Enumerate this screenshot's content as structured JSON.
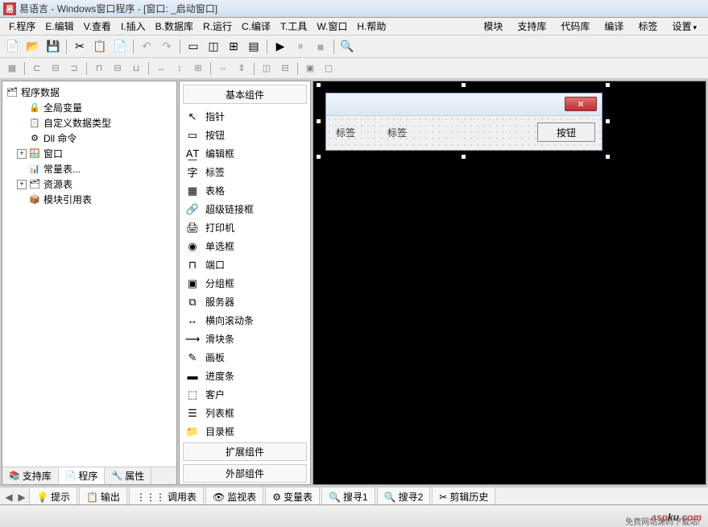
{
  "titlebar": {
    "app_name": "易语言",
    "project": "Windows窗口程序",
    "window": "[窗口: _启动窗口]"
  },
  "menubar": {
    "items": [
      {
        "label": "F.程序"
      },
      {
        "label": "E.编辑"
      },
      {
        "label": "V.查看"
      },
      {
        "label": "I.插入"
      },
      {
        "label": "B.数据库"
      },
      {
        "label": "R.运行"
      },
      {
        "label": "C.编译"
      },
      {
        "label": "T.工具"
      },
      {
        "label": "W.窗口"
      },
      {
        "label": "H.帮助"
      }
    ],
    "right": [
      {
        "label": "模块"
      },
      {
        "label": "支持库"
      },
      {
        "label": "代码库"
      },
      {
        "label": "编译"
      },
      {
        "label": "标签"
      },
      {
        "label": "设置"
      }
    ]
  },
  "tree": {
    "root": "程序数据",
    "items": [
      {
        "icon": "🔒",
        "label": "全局变量"
      },
      {
        "icon": "📋",
        "label": "自定义数据类型"
      },
      {
        "icon": "⚙",
        "label": "Dll 命令"
      },
      {
        "icon": "🪟",
        "label": "窗口",
        "expandable": true
      },
      {
        "icon": "📊",
        "label": "常量表..."
      },
      {
        "icon": "🗂",
        "label": "资源表",
        "expandable": true
      },
      {
        "icon": "📦",
        "label": "模块引用表"
      }
    ]
  },
  "left_tabs": [
    {
      "icon": "📚",
      "label": "支持库"
    },
    {
      "icon": "📄",
      "label": "程序",
      "active": true
    },
    {
      "icon": "🔧",
      "label": "属性"
    }
  ],
  "components": {
    "header": "基本组件",
    "items": [
      {
        "icon": "↖",
        "label": "指针"
      },
      {
        "icon": "▭",
        "label": "按钮"
      },
      {
        "icon": "A͟T",
        "label": "编辑框"
      },
      {
        "icon": "字",
        "label": "标签"
      },
      {
        "icon": "▦",
        "label": "表格"
      },
      {
        "icon": "🔗",
        "label": "超级链接框"
      },
      {
        "icon": "🖨",
        "label": "打印机"
      },
      {
        "icon": "◉",
        "label": "单选框"
      },
      {
        "icon": "⊓",
        "label": "端口"
      },
      {
        "icon": "▣",
        "label": "分组框"
      },
      {
        "icon": "⧉",
        "label": "服务器"
      },
      {
        "icon": "↔",
        "label": "横向滚动条"
      },
      {
        "icon": "⟿",
        "label": "滑块条"
      },
      {
        "icon": "✎",
        "label": "画板"
      },
      {
        "icon": "▬",
        "label": "进度条"
      },
      {
        "icon": "⬚",
        "label": "客户"
      },
      {
        "icon": "☰",
        "label": "列表框"
      },
      {
        "icon": "📁",
        "label": "目录框"
      }
    ],
    "footer1": "扩展组件",
    "footer2": "外部组件"
  },
  "design": {
    "label1": "标签",
    "label2": "标签",
    "button": "按钮",
    "close": "✕"
  },
  "bottom_tabs": [
    {
      "icon": "💡",
      "label": "提示"
    },
    {
      "icon": "📋",
      "label": "输出"
    },
    {
      "icon": "⋮⋮⋮",
      "label": "调用表"
    },
    {
      "icon": "👁",
      "label": "监视表"
    },
    {
      "icon": "⚙",
      "label": "变量表"
    },
    {
      "icon": "🔍",
      "label": "搜寻1"
    },
    {
      "icon": "🔍",
      "label": "搜寻2"
    },
    {
      "icon": "✂",
      "label": "剪辑历史"
    }
  ],
  "watermark": {
    "red": "asp",
    "black": "ku",
    "com": ".com",
    "sub": "免费网站源码下载站!"
  }
}
